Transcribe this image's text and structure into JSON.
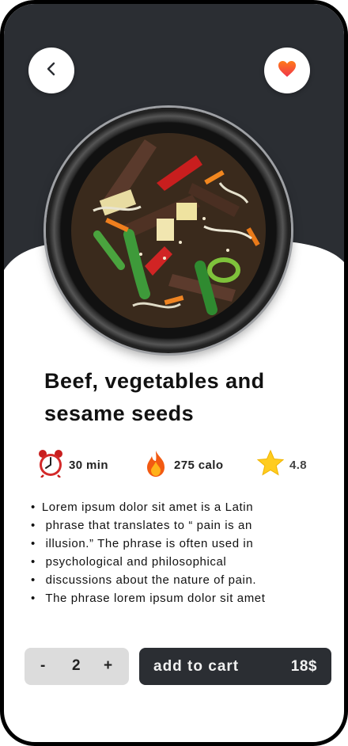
{
  "colors": {
    "dark": "#2b2e33",
    "accent_heart_top": "#ff7a1a",
    "accent_heart_bottom": "#f0354a",
    "quantity_bg": "#dcdcdc"
  },
  "header": {
    "back_icon": "chevron-left-icon",
    "favorite_icon": "heart-icon"
  },
  "dish": {
    "title": "Beef, vegetables and sesame seeds"
  },
  "stats": {
    "time": {
      "icon": "alarm-clock-icon",
      "text": "30 min"
    },
    "calories": {
      "icon": "fire-icon",
      "text": "275 calo"
    },
    "rating": {
      "icon": "star-icon",
      "text": "4.8"
    }
  },
  "description": [
    "Lorem ipsum dolor sit amet is a Latin",
    " phrase that translates to “ pain is an",
    " illusion.” The phrase is often used in",
    " psychological and philosophical",
    " discussions about the nature of pain.",
    " The phrase lorem ipsum dolor sit amet"
  ],
  "quantity": {
    "minus": "-",
    "value": "2",
    "plus": "+"
  },
  "cart": {
    "label": "add to cart",
    "price": "18$"
  }
}
